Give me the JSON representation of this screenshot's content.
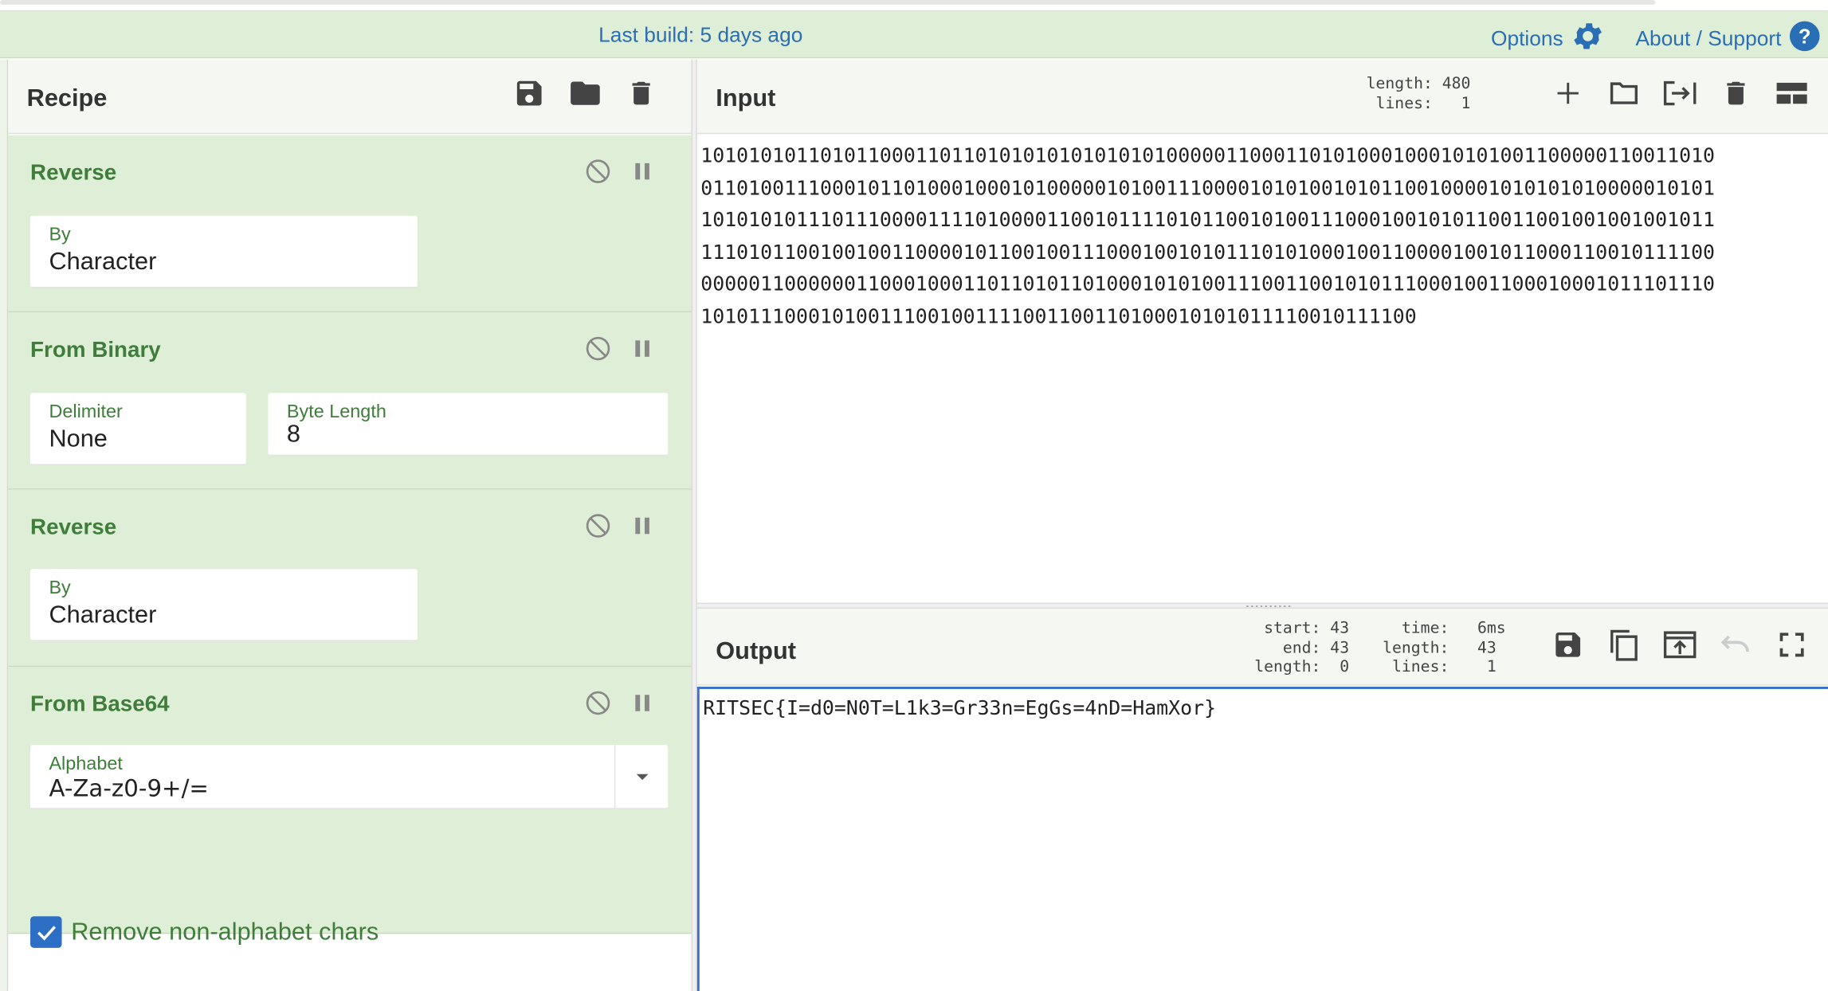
{
  "banner": {
    "build": "Last build: 5 days ago",
    "options": "Options",
    "about": "About / Support"
  },
  "recipe": {
    "title": "Recipe",
    "operations": [
      {
        "name": "Reverse",
        "fields": [
          {
            "label": "By",
            "value": "Character"
          }
        ]
      },
      {
        "name": "From Binary",
        "fields": [
          {
            "label": "Delimiter",
            "value": "None"
          },
          {
            "label": "Byte Length",
            "value": "8"
          }
        ]
      },
      {
        "name": "Reverse",
        "fields": [
          {
            "label": "By",
            "value": "Character"
          }
        ]
      },
      {
        "name": "From Base64",
        "fields": [
          {
            "label": "Alphabet",
            "value": "A-Za-z0-9+/="
          }
        ],
        "checkbox": {
          "label": "Remove non-alphabet chars",
          "checked": true
        }
      }
    ]
  },
  "input": {
    "title": "Input",
    "stats": "length: 480\n lines:   1",
    "lines": [
      "1010101011010110001101101010101010101010000011000110101000100010101001100000110011010",
      "0110100111000101101000100010100000101001110000101010010101100100001010101010000010101",
      "1010101011101110000111101000011001011110101100101001110001001010110011001001001001011",
      "1110101100100100110000101100100111000100101011101010001001100001001011000110010111100",
      "0000011000000110001000110110101101000101010011100110010101110001001100010001011101110",
      "101011100010100111001001111001100110100010101011110010111100"
    ]
  },
  "output": {
    "title": "Output",
    "stats_left": "start: 43\n  end: 43\nlength:  0",
    "stats_right": "  time:   6ms\nlength:   43\n lines:    1",
    "text": "RITSEC{I=d0=N0T=L1k3=Gr33n=EgGs=4nD=HamXor}"
  },
  "colors": {
    "accent_green": "#3f7d3b",
    "op_bg": "#dfeed6",
    "link_blue": "#2a6fb5",
    "checkbox_blue": "#2e6fc6"
  }
}
